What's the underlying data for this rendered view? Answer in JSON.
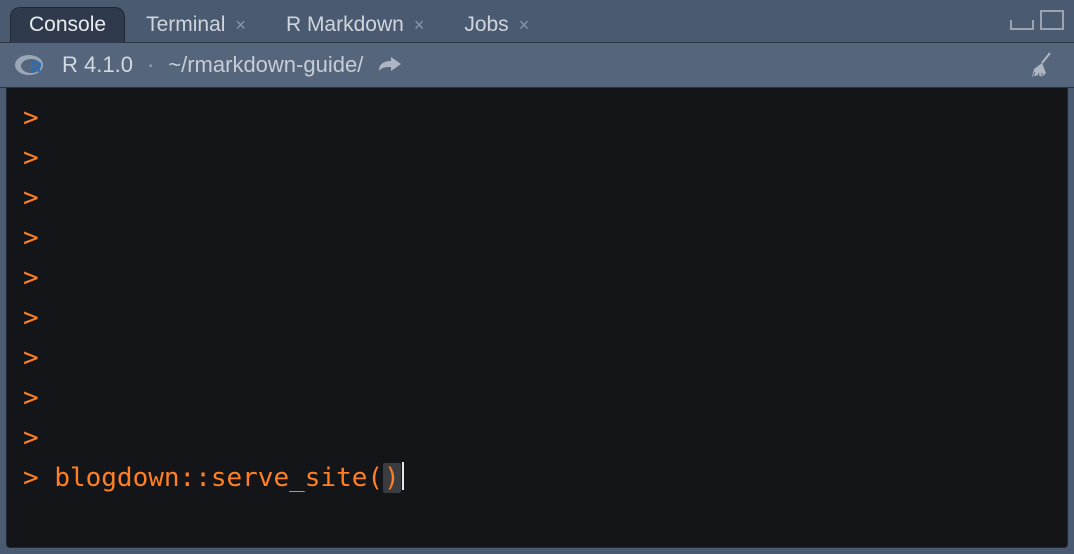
{
  "tabs": [
    {
      "label": "Console",
      "closable": false,
      "active": true
    },
    {
      "label": "Terminal",
      "closable": true,
      "active": false
    },
    {
      "label": "R Markdown",
      "closable": true,
      "active": false
    },
    {
      "label": "Jobs",
      "closable": true,
      "active": false
    }
  ],
  "info": {
    "version": "R 4.1.0",
    "separator": "·",
    "path": "~/rmarkdown-guide/"
  },
  "console": {
    "prompt": ">",
    "blank_prompt_lines": 9,
    "input_line": "blogdown::serve_site(",
    "input_trail": ")"
  },
  "icons": {
    "r_logo": "r-logo-icon",
    "share": "share-arrow-icon",
    "broom": "broom-icon",
    "minimize": "minimize-icon",
    "maximize": "maximize-icon"
  }
}
